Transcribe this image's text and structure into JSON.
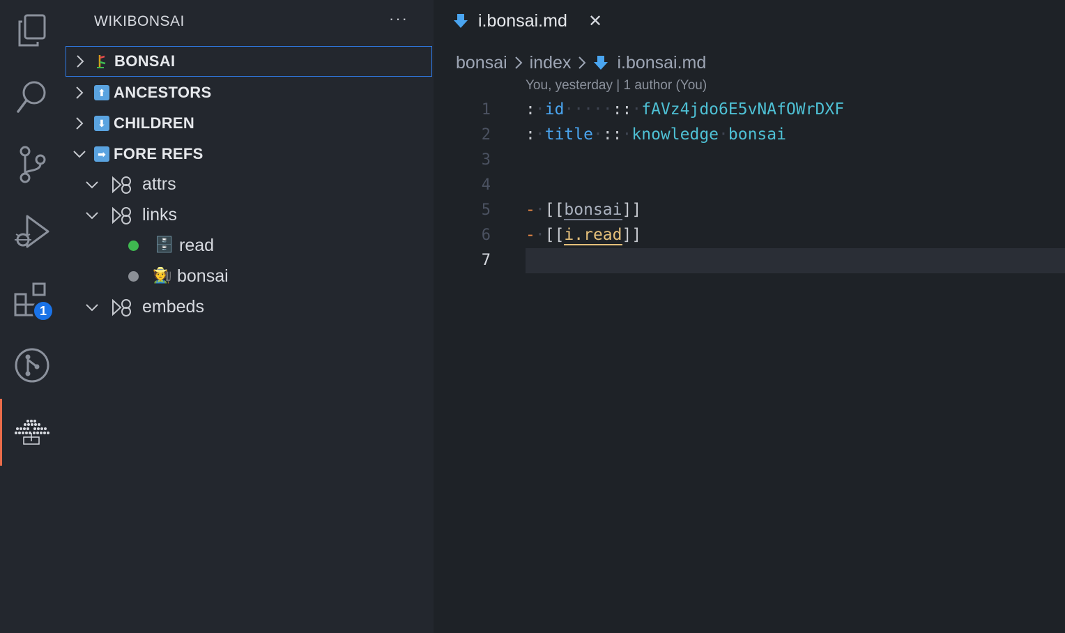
{
  "activity_bar": {
    "items": [
      {
        "name": "explorer-icon"
      },
      {
        "name": "search-icon"
      },
      {
        "name": "source-control-icon"
      },
      {
        "name": "run-debug-icon"
      },
      {
        "name": "extensions-icon",
        "badge": "1"
      },
      {
        "name": "git-graph-icon"
      },
      {
        "name": "wikibonsai-icon",
        "active": true
      }
    ],
    "accent_color": "#ea6c4a",
    "badge_color": "#1a73e8"
  },
  "sidebar": {
    "title": "WIKIBONSAI",
    "more": "···",
    "sections": [
      {
        "label": "BONSAI",
        "icon": "bonsai-tree-icon",
        "expanded": false
      },
      {
        "label": "ANCESTORS",
        "icon": "up-arrow-icon",
        "expanded": false
      },
      {
        "label": "CHILDREN",
        "icon": "down-arrow-icon",
        "expanded": false
      },
      {
        "label": "FORE REFS",
        "icon": "right-arrow-icon",
        "expanded": true
      }
    ],
    "fore_refs": {
      "groups": [
        {
          "label": "attrs"
        },
        {
          "label": "links"
        },
        {
          "label": "embeds"
        }
      ],
      "links": [
        {
          "label": "read",
          "status_color": "#3fb950",
          "emoji": "🗄️"
        },
        {
          "label": "bonsai",
          "status_color": "#8b8f96",
          "emoji": "🧑‍🌾"
        }
      ]
    }
  },
  "editor": {
    "tab": {
      "label": "i.bonsai.md",
      "close": "✕"
    },
    "breadcrumb": [
      "bonsai",
      "index",
      "i.bonsai.md"
    ],
    "blame": "You, yesterday | 1 author (You)",
    "line_numbers": [
      "1",
      "2",
      "3",
      "4",
      "5",
      "6",
      "7"
    ],
    "current_line": "7",
    "lines": {
      "l1": {
        "colon": ":",
        "key": "id",
        "ws": "···",
        "sep": "::",
        "value": "fAVz4jdo6E5vNAfOWrDXF"
      },
      "l2": {
        "colon": ":",
        "key": "title",
        "sep": "::",
        "value1": "knowledge",
        "value2": "bonsai"
      },
      "l5": {
        "dash": "-",
        "open": "[[",
        "link": "bonsai",
        "close": "]]"
      },
      "l6": {
        "dash": "-",
        "open": "[[",
        "link": "i.read",
        "close": "]]"
      }
    }
  }
}
